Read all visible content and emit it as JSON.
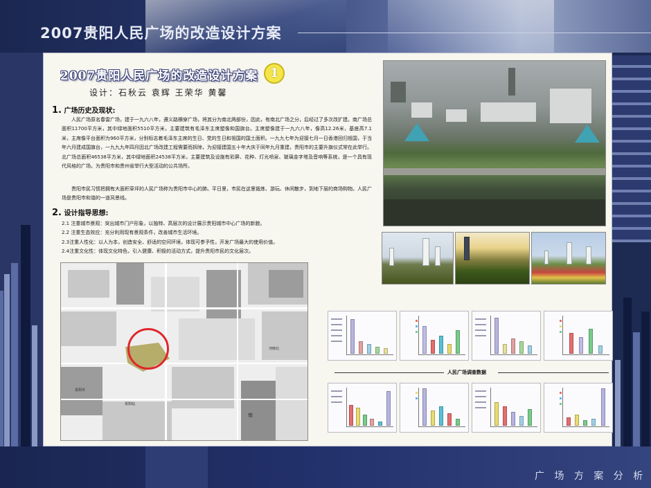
{
  "header": {
    "title": "2007贵阳人民广场的改造设计方案"
  },
  "footer": {
    "caption": "广 场 方 案 分 析"
  },
  "doc": {
    "title": "2007贵阳人民广场的改造设计方案",
    "number": "1",
    "authors": "设计：石秋云  袁辉  王荣华  黄馨"
  },
  "section1": {
    "num": "1.",
    "heading": "广场历史及现状:",
    "p1": "人民广场原名春雷广场，建于一九六八年，遵义路横穿广场，将其分为南北两部份，因此，有南北广场之分，后经过了多次改扩建。南广场总面积11700平方米，其中绿地面积5510平方米，主要建筑有毛泽东主席塑像和国旗台。主席塑像建于一九六八年，像高12.26米，基座高7.1米，主席像平台面积为960平方米，分别标志着毛泽东主席的生日、党的生日和祖国的国土面积。一九九七年为迎接七月一日香港回归祖国，于当年六月建成国旗台，一九九九年四月因北广场改建工程需要而拆除，为迎接建国五十年大庆于同年九月重建，贵阳市的主要升旗仪式常在此举行。北广场总面积46538平方米，其中绿地面积24538平方米，主要建筑及设施有彩屏、花种、灯光喷泉、玻璃金字塔及音响等系统，是一个具有现代风格的广场。为贵阳市和贵州省举行大型活动的公共场所。",
    "p2": "贵阳市民习惯把拥有大面积草坪的人民广场称为贵阳市中心的肺。平日里，市民在这里锻炼、游玩、休闲散步，到地下层的商场购物。人民广场是贵阳市和谐的一道风景线。"
  },
  "section2": {
    "num": "2.",
    "heading": "设计指导思想:",
    "items": [
      "2.1 注重城市景观：突出城市门户形象，以独特、高层次的设计展示贵阳城市中心广场的新貌。",
      "2.2 注重生态效应：充分利用现有景观条件，改善城市生活环境。",
      "2.3注重人性化：以人为本，创造安全、舒适的空间环境，体现可参予性，开发广场最大的使用价值。",
      "2.4注重文化性：体现文化特色，引入健康、积极的活动方式，提升贵阳市民的文化层次。"
    ]
  },
  "map": {
    "labels": [
      "贵阳站",
      "南",
      "河南北",
      "贵阳市"
    ]
  },
  "survey": {
    "title": "人民广场调查数据"
  },
  "colors": {
    "bg": "#1d2a52",
    "board": "#f7f6ef",
    "accent_red": "#e0262a",
    "badge_yellow": "#f4e64a"
  }
}
